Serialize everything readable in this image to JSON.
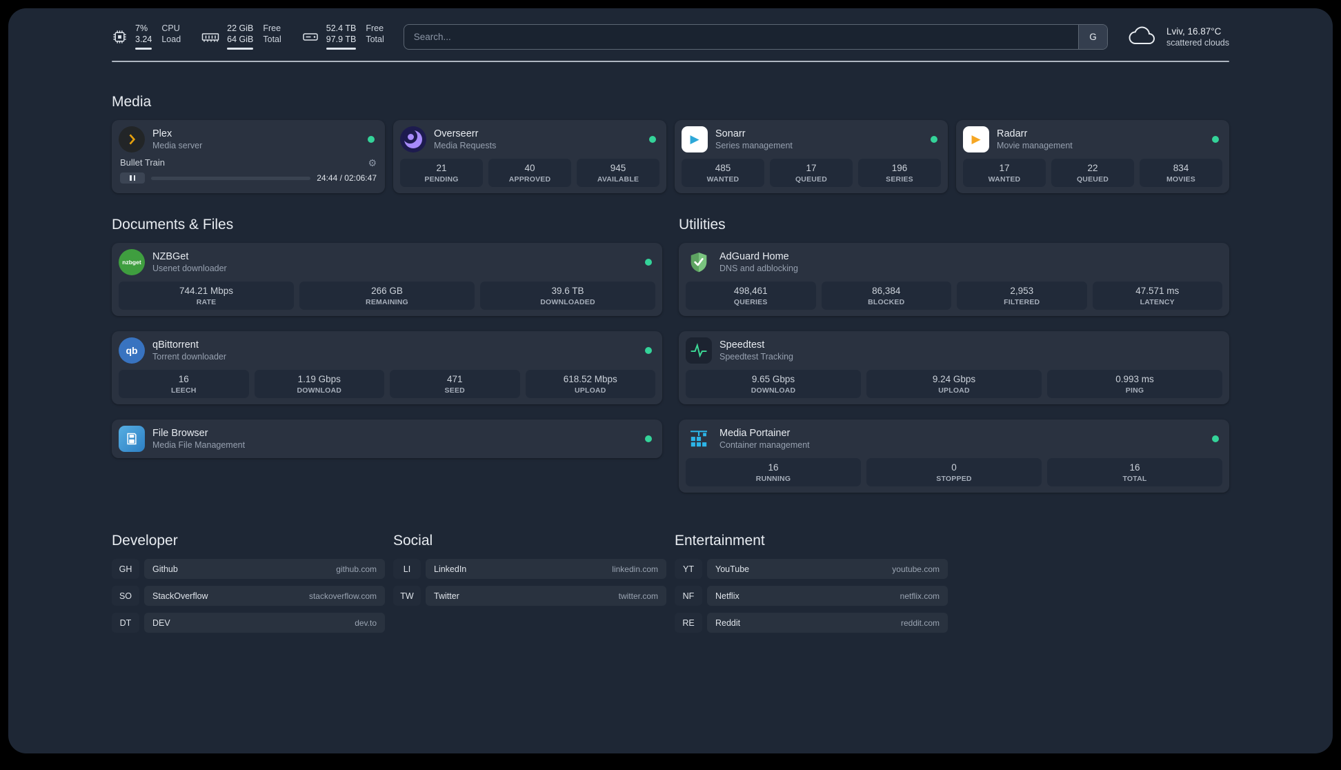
{
  "colors": {
    "status_online": "#34d399",
    "page_background": "#1e2735",
    "card_background": "#2a3240",
    "stat_tile_background": "#212a39",
    "plex_accent": "#e5a00d",
    "overseerr_accent": "#a78bfa",
    "sonarr_accent": "#2da8d8",
    "radarr_accent": "#f5a623",
    "nzbget_accent": "#3f9e3f",
    "qbittorrent_accent": "#3873c0",
    "adguard_accent": "#68b578",
    "speedtest_accent": "#3ddc97",
    "portainer_accent": "#2cb5e8"
  },
  "icon_glyphs": {
    "gear": "⚙",
    "play": "▶",
    "nzbget_text": "nzbget",
    "qbittorrent_text": "qb"
  },
  "header": {
    "monitors": [
      {
        "icon": "cpu-icon",
        "values": [
          "7%",
          "3.24"
        ],
        "labels": [
          "CPU",
          "Load"
        ]
      },
      {
        "icon": "memory-icon",
        "values": [
          "22 GiB",
          "64 GiB"
        ],
        "labels": [
          "Free",
          "Total"
        ]
      },
      {
        "icon": "disk-icon",
        "values": [
          "52.4 TB",
          "97.9 TB"
        ],
        "labels": [
          "Free",
          "Total"
        ]
      }
    ],
    "search": {
      "placeholder": "Search...",
      "button_label": "G"
    },
    "weather": {
      "location": "Lviv, 16.87°C",
      "condition": "scattered clouds"
    }
  },
  "sections": {
    "media": {
      "title": "Media",
      "cards": [
        {
          "name": "Plex",
          "description": "Media server",
          "status": "online",
          "player": {
            "track": "Bullet Train",
            "time": "24:44 / 02:06:47"
          }
        },
        {
          "name": "Overseerr",
          "description": "Media Requests",
          "status": "online",
          "stats": [
            {
              "value": "21",
              "label": "PENDING"
            },
            {
              "value": "40",
              "label": "APPROVED"
            },
            {
              "value": "945",
              "label": "AVAILABLE"
            }
          ]
        },
        {
          "name": "Sonarr",
          "description": "Series management",
          "status": "online",
          "stats": [
            {
              "value": "485",
              "label": "WANTED"
            },
            {
              "value": "17",
              "label": "QUEUED"
            },
            {
              "value": "196",
              "label": "SERIES"
            }
          ]
        },
        {
          "name": "Radarr",
          "description": "Movie management",
          "status": "online",
          "stats": [
            {
              "value": "17",
              "label": "WANTED"
            },
            {
              "value": "22",
              "label": "QUEUED"
            },
            {
              "value": "834",
              "label": "MOVIES"
            }
          ]
        }
      ]
    },
    "documents": {
      "title": "Documents & Files",
      "cards": [
        {
          "name": "NZBGet",
          "description": "Usenet downloader",
          "status": "online",
          "stats": [
            {
              "value": "744.21 Mbps",
              "label": "RATE"
            },
            {
              "value": "266 GB",
              "label": "REMAINING"
            },
            {
              "value": "39.6 TB",
              "label": "DOWNLOADED"
            }
          ]
        },
        {
          "name": "qBittorrent",
          "description": "Torrent downloader",
          "status": "online",
          "stats": [
            {
              "value": "16",
              "label": "LEECH"
            },
            {
              "value": "1.19 Gbps",
              "label": "DOWNLOAD"
            },
            {
              "value": "471",
              "label": "SEED"
            },
            {
              "value": "618.52 Mbps",
              "label": "UPLOAD"
            }
          ]
        },
        {
          "name": "File Browser",
          "description": "Media File Management",
          "status": "online"
        }
      ]
    },
    "utilities": {
      "title": "Utilities",
      "cards": [
        {
          "name": "AdGuard Home",
          "description": "DNS and adblocking",
          "stats": [
            {
              "value": "498,461",
              "label": "QUERIES"
            },
            {
              "value": "86,384",
              "label": "BLOCKED"
            },
            {
              "value": "2,953",
              "label": "FILTERED"
            },
            {
              "value": "47.571 ms",
              "label": "LATENCY"
            }
          ]
        },
        {
          "name": "Speedtest",
          "description": "Speedtest Tracking",
          "stats": [
            {
              "value": "9.65 Gbps",
              "label": "DOWNLOAD"
            },
            {
              "value": "9.24 Gbps",
              "label": "UPLOAD"
            },
            {
              "value": "0.993 ms",
              "label": "PING"
            }
          ]
        },
        {
          "name": "Media Portainer",
          "description": "Container management",
          "status": "online",
          "stats": [
            {
              "value": "16",
              "label": "RUNNING"
            },
            {
              "value": "0",
              "label": "STOPPED"
            },
            {
              "value": "16",
              "label": "TOTAL"
            }
          ]
        }
      ]
    }
  },
  "bookmarks": [
    {
      "title": "Developer",
      "links": [
        {
          "abbr": "GH",
          "name": "Github",
          "url": "github.com"
        },
        {
          "abbr": "SO",
          "name": "StackOverflow",
          "url": "stackoverflow.com"
        },
        {
          "abbr": "DT",
          "name": "DEV",
          "url": "dev.to"
        }
      ]
    },
    {
      "title": "Social",
      "links": [
        {
          "abbr": "LI",
          "name": "LinkedIn",
          "url": "linkedin.com"
        },
        {
          "abbr": "TW",
          "name": "Twitter",
          "url": "twitter.com"
        }
      ]
    },
    {
      "title": "Entertainment",
      "links": [
        {
          "abbr": "YT",
          "name": "YouTube",
          "url": "youtube.com"
        },
        {
          "abbr": "NF",
          "name": "Netflix",
          "url": "netflix.com"
        },
        {
          "abbr": "RE",
          "name": "Reddit",
          "url": "reddit.com"
        }
      ]
    }
  ]
}
